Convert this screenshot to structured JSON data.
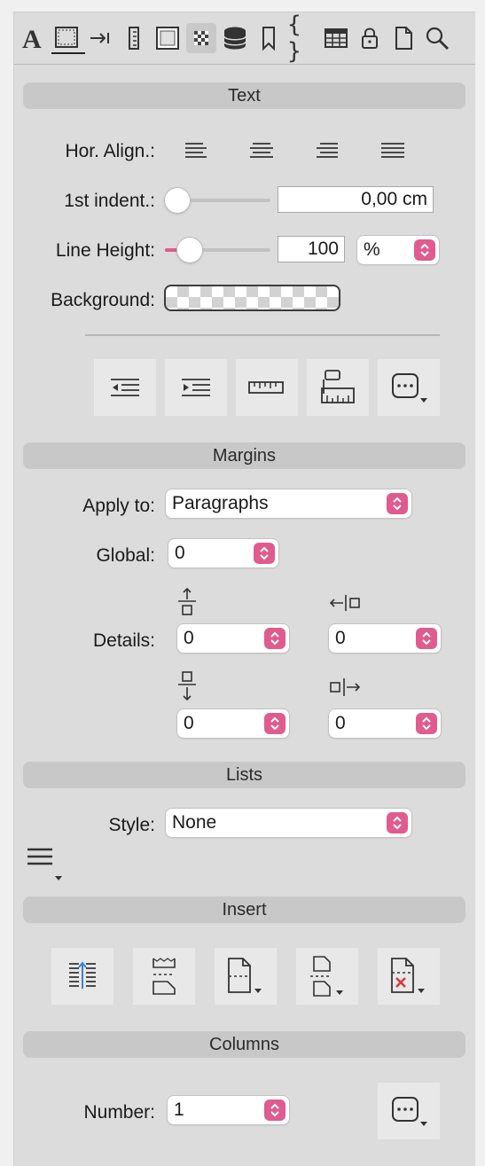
{
  "toolbar": {
    "tabs": [
      {
        "name": "text-style",
        "icon": "letter-a-icon"
      },
      {
        "name": "frame",
        "icon": "selection-frame-icon",
        "active": true
      },
      {
        "name": "tab-stop",
        "icon": "tab-arrow-icon"
      },
      {
        "name": "ruler",
        "icon": "vertical-ruler-icon"
      },
      {
        "name": "border",
        "icon": "border-box-icon"
      },
      {
        "name": "fill",
        "icon": "checker-fill-icon"
      },
      {
        "name": "database",
        "icon": "database-icon"
      },
      {
        "name": "bookmark",
        "icon": "bookmark-icon"
      },
      {
        "name": "code",
        "icon": "braces-icon",
        "glyph": "{ }"
      },
      {
        "name": "table",
        "icon": "table-icon"
      },
      {
        "name": "lock",
        "icon": "lock-icon"
      },
      {
        "name": "page",
        "icon": "document-icon"
      },
      {
        "name": "search",
        "icon": "magnifier-icon"
      }
    ]
  },
  "text_section": {
    "title": "Text",
    "hor_align_label": "Hor. Align.:",
    "first_indent_label": "1st indent.:",
    "first_indent_value": "0,00 cm",
    "first_indent_slider": 0,
    "line_height_label": "Line Height:",
    "line_height_value": "100",
    "line_height_unit": "%",
    "line_height_slider": 0.1,
    "background_label": "Background:"
  },
  "margins_section": {
    "title": "Margins",
    "apply_to_label": "Apply to:",
    "apply_to_value": "Paragraphs",
    "global_label": "Global:",
    "global_value": "0",
    "details_label": "Details:",
    "top_value": "0",
    "left_value": "0",
    "bottom_value": "0",
    "right_value": "0"
  },
  "lists_section": {
    "title": "Lists",
    "style_label": "Style:",
    "style_value": "None"
  },
  "insert_section": {
    "title": "Insert"
  },
  "columns_section": {
    "title": "Columns",
    "number_label": "Number:",
    "number_value": "1"
  },
  "colors": {
    "accent": "#e05b8e",
    "panel": "#dcdcdc",
    "header": "#c8c8c8"
  }
}
